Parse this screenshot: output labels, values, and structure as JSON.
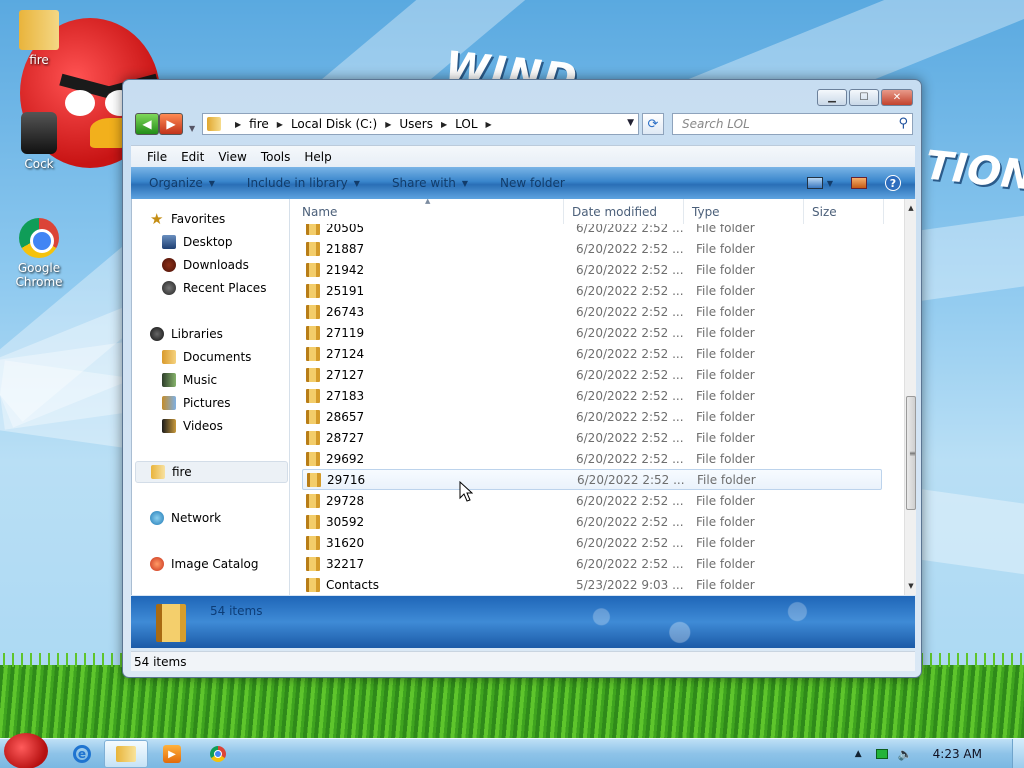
{
  "desktop": {
    "icons": [
      {
        "label": "fire",
        "icon": "user-folder-icon"
      },
      {
        "label": "Cock",
        "icon": "recycle-bin-icon"
      },
      {
        "label": "Google Chrome",
        "icon": "chrome-icon"
      }
    ]
  },
  "window": {
    "controls": {
      "minimize": "▁",
      "maximize": "☐",
      "close": "✕"
    },
    "address": {
      "crumbs": [
        "fire",
        "Local Disk (C:)",
        "Users",
        "LOL"
      ]
    },
    "search": {
      "placeholder": "Search LOL"
    },
    "menu": [
      "File",
      "Edit",
      "View",
      "Tools",
      "Help"
    ],
    "commands": {
      "organize": "Organize",
      "include_in_library": "Include in library",
      "share_with": "Share with",
      "new_folder": "New folder"
    },
    "nav_pane": {
      "favorites": {
        "label": "Favorites",
        "items": [
          "Desktop",
          "Downloads",
          "Recent Places"
        ]
      },
      "libraries": {
        "label": "Libraries",
        "items": [
          "Documents",
          "Music",
          "Pictures",
          "Videos"
        ]
      },
      "user": "fire",
      "network": "Network",
      "image_catalog": "Image Catalog"
    },
    "columns": {
      "name": "Name",
      "date": "Date modified",
      "type": "Type",
      "size": "Size"
    },
    "files": [
      {
        "name": "20505",
        "date": "6/20/2022 2:52 ...",
        "type": "File folder"
      },
      {
        "name": "21887",
        "date": "6/20/2022 2:52 ...",
        "type": "File folder"
      },
      {
        "name": "21942",
        "date": "6/20/2022 2:52 ...",
        "type": "File folder"
      },
      {
        "name": "25191",
        "date": "6/20/2022 2:52 ...",
        "type": "File folder"
      },
      {
        "name": "26743",
        "date": "6/20/2022 2:52 ...",
        "type": "File folder"
      },
      {
        "name": "27119",
        "date": "6/20/2022 2:52 ...",
        "type": "File folder"
      },
      {
        "name": "27124",
        "date": "6/20/2022 2:52 ...",
        "type": "File folder"
      },
      {
        "name": "27127",
        "date": "6/20/2022 2:52 ...",
        "type": "File folder"
      },
      {
        "name": "27183",
        "date": "6/20/2022 2:52 ...",
        "type": "File folder"
      },
      {
        "name": "28657",
        "date": "6/20/2022 2:52 ...",
        "type": "File folder"
      },
      {
        "name": "28727",
        "date": "6/20/2022 2:52 ...",
        "type": "File folder"
      },
      {
        "name": "29692",
        "date": "6/20/2022 2:52 ...",
        "type": "File folder"
      },
      {
        "name": "29716",
        "date": "6/20/2022 2:52 ...",
        "type": "File folder"
      },
      {
        "name": "29728",
        "date": "6/20/2022 2:52 ...",
        "type": "File folder"
      },
      {
        "name": "30592",
        "date": "6/20/2022 2:52 ...",
        "type": "File folder"
      },
      {
        "name": "31620",
        "date": "6/20/2022 2:52 ...",
        "type": "File folder"
      },
      {
        "name": "32217",
        "date": "6/20/2022 2:52 ...",
        "type": "File folder"
      },
      {
        "name": "Contacts",
        "date": "5/23/2022 9:03 ...",
        "type": "File folder"
      }
    ],
    "hovered_file": "29716",
    "details_count": "54 items",
    "status_count": "54 items"
  },
  "taskbar": {
    "clock": "4:23 AM",
    "apps": [
      "internet-explorer-icon",
      "windows-explorer-icon",
      "media-player-icon",
      "chrome-icon"
    ]
  }
}
